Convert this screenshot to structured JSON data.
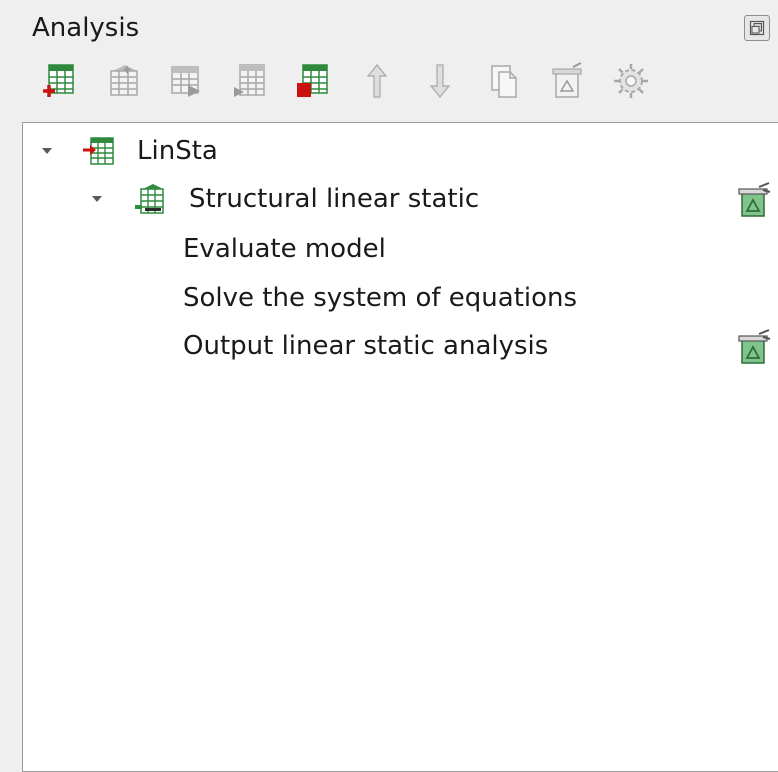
{
  "panel": {
    "title": "Analysis",
    "float_icon": "float-panel-icon"
  },
  "toolbar": {
    "buttons": [
      {
        "icon": "new-analysis-icon",
        "state": "enabled"
      },
      {
        "icon": "new-analysis-step-icon",
        "state": "disabled"
      },
      {
        "icon": "new-solver-icon",
        "state": "disabled"
      },
      {
        "icon": "new-output-icon",
        "state": "disabled"
      },
      {
        "icon": "remove-item-icon",
        "state": "enabled"
      },
      {
        "icon": "move-up-icon",
        "state": "disabled"
      },
      {
        "icon": "move-down-icon",
        "state": "disabled"
      },
      {
        "icon": "copy-icon",
        "state": "disabled"
      },
      {
        "icon": "clear-results-icon",
        "state": "disabled"
      },
      {
        "icon": "run-analysis-icon",
        "state": "disabled"
      }
    ]
  },
  "tree": {
    "analysis": {
      "label": "LinSta",
      "expanded": true,
      "icon": "analysis-case-icon"
    },
    "step": {
      "label": "Structural linear static",
      "expanded": true,
      "icon": "analysis-step-icon",
      "trailing_icon": "clear-results-icon"
    },
    "tasks": [
      {
        "label": "Evaluate model"
      },
      {
        "label": "Solve the system of equations"
      },
      {
        "label": "Output linear static analysis",
        "trailing_icon": "clear-results-icon"
      }
    ]
  },
  "colors": {
    "grid_green": "#2f8a3e",
    "accent_red": "#cc1111",
    "trash_green": "#7fc48a"
  }
}
